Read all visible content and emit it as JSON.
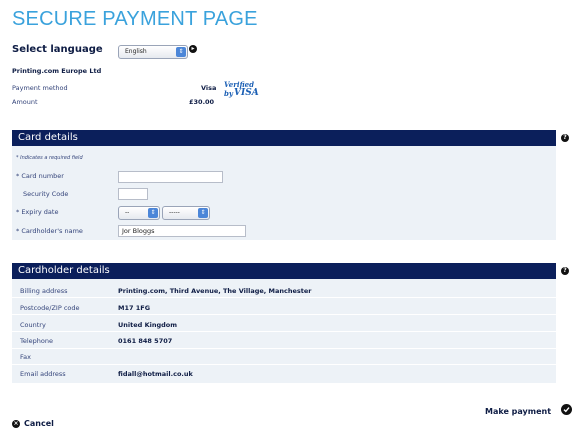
{
  "page": {
    "title": "SECURE PAYMENT PAGE"
  },
  "language": {
    "label": "Select language",
    "selected": "English",
    "arrow": "⇕"
  },
  "merchant": {
    "company": "Printing.com Europe Ltd",
    "payment_method_label": "Payment method",
    "payment_method_value": "Visa",
    "amount_label": "Amount",
    "amount_value": "£30.00",
    "visa_logo_line1": "Verified by",
    "visa_logo_line2": "VISA"
  },
  "card_details": {
    "header": "Card details",
    "required_note": "* Indicates a required field",
    "card_number_label": "* Card number",
    "card_number_value": "",
    "security_code_label": "Security Code",
    "security_code_value": "",
    "expiry_label": "* Expiry date",
    "expiry_month": "--",
    "expiry_year": "-----",
    "cardholder_label": "* Cardholder's name",
    "cardholder_value": "Jor Bloggs"
  },
  "cardholder_details": {
    "header": "Cardholder details",
    "rows": [
      {
        "label": "Billing address",
        "value": "Printing.com, Third Avenue, The Village, Manchester"
      },
      {
        "label": "Postcode/ZIP code",
        "value": "M17 1FG"
      },
      {
        "label": "Country",
        "value": "United Kingdom"
      },
      {
        "label": "Telephone",
        "value": "0161 848 5707"
      },
      {
        "label": "Fax",
        "value": ""
      },
      {
        "label": "Email address",
        "value": "fidall@hotmail.co.uk"
      }
    ]
  },
  "actions": {
    "cancel_label": "Cancel",
    "make_payment_label": "Make payment"
  },
  "icons": {
    "arrow_right": "▸",
    "help": "?",
    "close": "×"
  },
  "colors": {
    "title": "#3aa2dc",
    "panel_header": "#0b1f5b",
    "panel_body": "#edf2f7"
  }
}
